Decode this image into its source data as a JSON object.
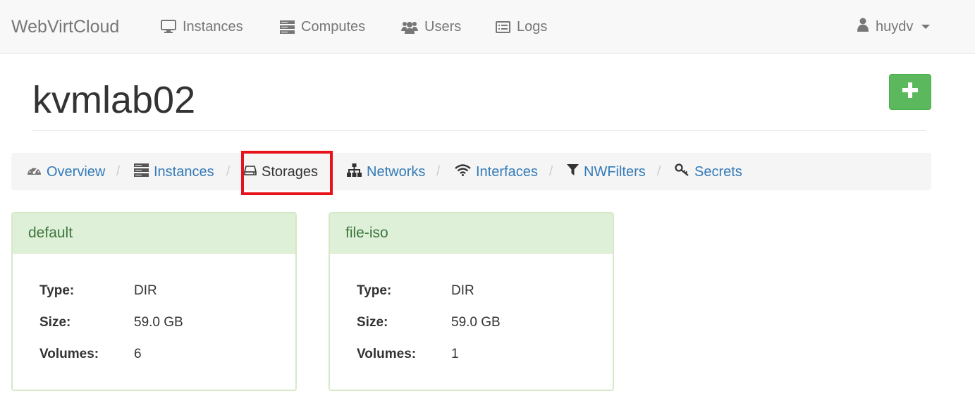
{
  "navbar": {
    "brand": "WebVirtCloud",
    "links": [
      {
        "label": "Instances",
        "icon": "monitor-icon"
      },
      {
        "label": "Computes",
        "icon": "server-icon"
      },
      {
        "label": "Users",
        "icon": "users-icon"
      },
      {
        "label": "Logs",
        "icon": "list-icon"
      }
    ],
    "user": {
      "name": "huydv",
      "icon": "user-icon"
    }
  },
  "page": {
    "title": "kvmlab02",
    "add_button_icon": "plus-icon",
    "add_button_color": "#5cb85c"
  },
  "breadcrumb": {
    "items": [
      {
        "label": "Overview",
        "icon": "dashboard-icon",
        "active": false
      },
      {
        "label": "Instances",
        "icon": "server-icon",
        "active": false
      },
      {
        "label": "Storages",
        "icon": "hdd-icon",
        "active": true
      },
      {
        "label": "Networks",
        "icon": "sitemap-icon",
        "active": false
      },
      {
        "label": "Interfaces",
        "icon": "wifi-icon",
        "active": false
      },
      {
        "label": "NWFilters",
        "icon": "filter-icon",
        "active": false
      },
      {
        "label": "Secrets",
        "icon": "key-icon",
        "active": false
      }
    ],
    "separator": "/",
    "highlight_color": "#e8121b"
  },
  "storages": [
    {
      "name": "default",
      "type_label": "Type:",
      "type": "DIR",
      "size_label": "Size:",
      "size": "59.0 GB",
      "volumes_label": "Volumes:",
      "volumes": "6"
    },
    {
      "name": "file-iso",
      "type_label": "Type:",
      "type": "DIR",
      "size_label": "Size:",
      "size": "59.0 GB",
      "volumes_label": "Volumes:",
      "volumes": "1"
    }
  ],
  "colors": {
    "link": "#337ab7",
    "panel_heading_bg": "#dff0d8",
    "panel_heading_text": "#3c763d"
  }
}
